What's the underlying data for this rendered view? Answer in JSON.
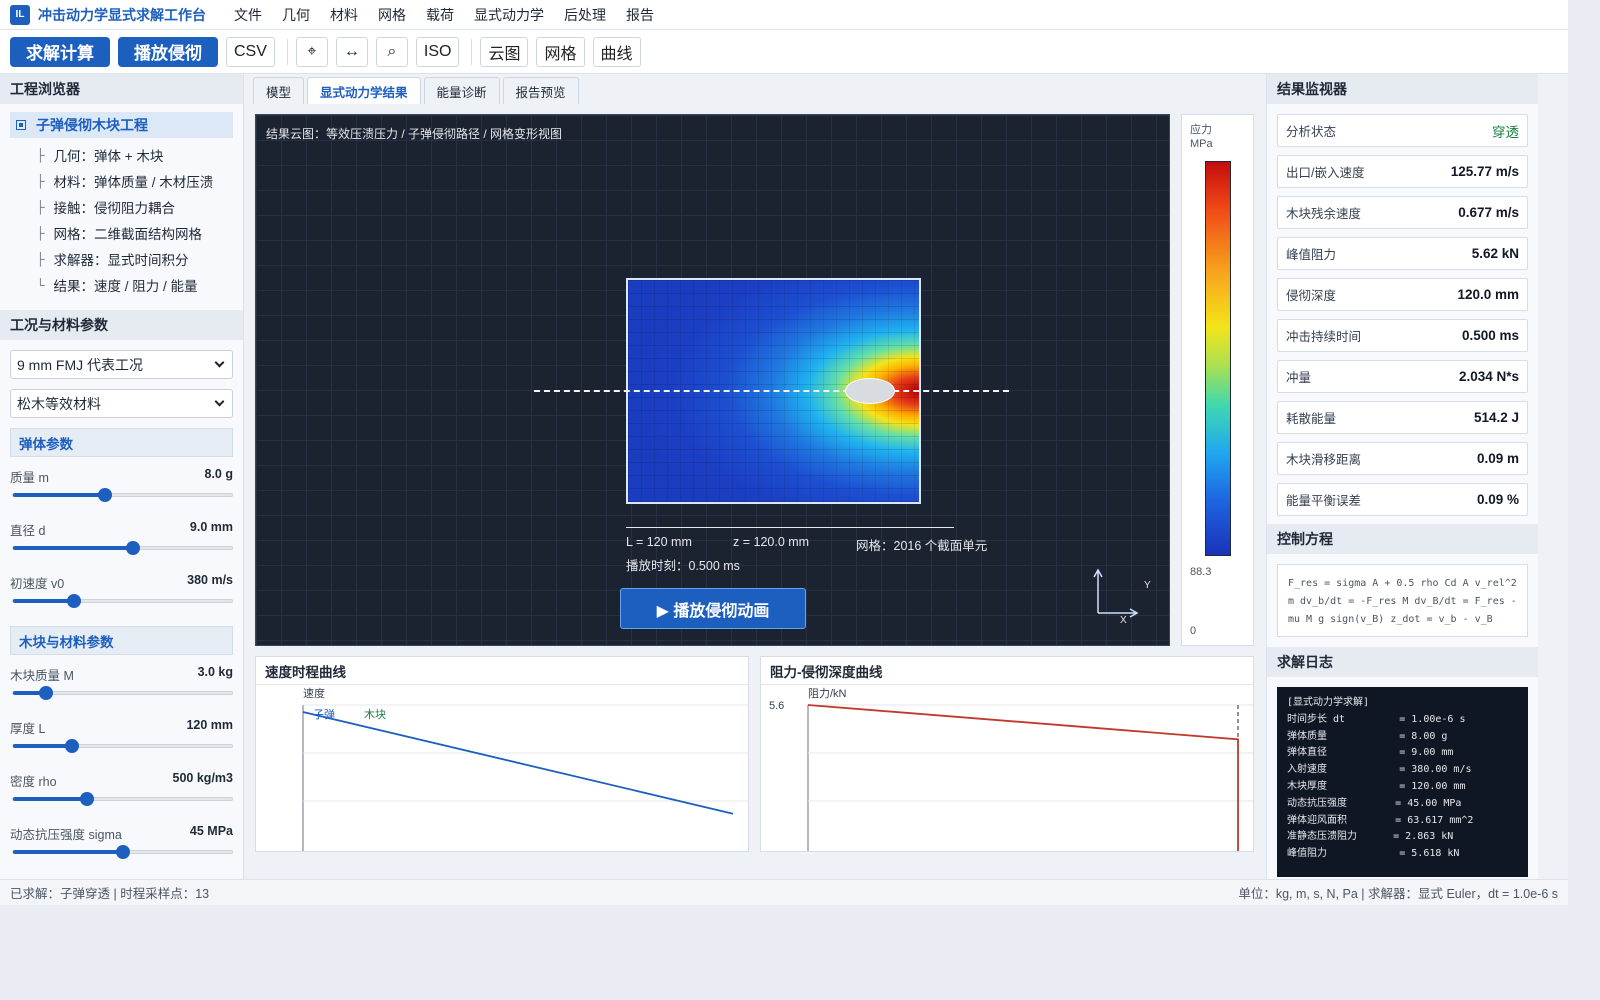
{
  "app": {
    "logo": "IL",
    "title": "冲击动力学显式求解工作台"
  },
  "menu": [
    "文件",
    "几何",
    "材料",
    "网格",
    "载荷",
    "显式动力学",
    "后处理",
    "报告"
  ],
  "toolbar": {
    "solve": "求解计算",
    "play": "播放侵彻",
    "csv": "CSV",
    "fit": "⌖",
    "pan": "↔",
    "zoom": "⌕",
    "iso": "ISO",
    "contour": "云图",
    "mesh": "网格",
    "curve": "曲线"
  },
  "browser": {
    "title": "工程浏览器",
    "root": "子弹侵彻木块工程",
    "items": [
      {
        "branch": "├",
        "label": "几何：弹体 + 木块"
      },
      {
        "branch": "├",
        "label": "材料：弹体质量 / 木材压溃"
      },
      {
        "branch": "├",
        "label": "接触：侵彻阻力耦合"
      },
      {
        "branch": "├",
        "label": "网格：二维截面结构网格"
      },
      {
        "branch": "├",
        "label": "求解器：显式时间积分"
      },
      {
        "branch": "└",
        "label": "结果：速度 / 阻力 / 能量"
      }
    ]
  },
  "params": {
    "title": "工况与材料参数",
    "case": "9 mm FMJ 代表工况",
    "material": "松木等效材料",
    "bullet_title": "弹体参数",
    "bullet": [
      {
        "label": "质量 m",
        "value": "8.0 g",
        "fraction": 0.42
      },
      {
        "label": "直径 d",
        "value": "9.0 mm",
        "fraction": 0.55
      },
      {
        "label": "初速度 v0",
        "value": "380 m/s",
        "fraction": 0.28
      }
    ],
    "block_title": "木块与材料参数",
    "block": [
      {
        "label": "木块质量 M",
        "value": "3.0 kg",
        "fraction": 0.15
      },
      {
        "label": "厚度 L",
        "value": "120 mm",
        "fraction": 0.27
      },
      {
        "label": "密度 rho",
        "value": "500 kg/m3",
        "fraction": 0.34
      },
      {
        "label": "动态抗压强度 sigma",
        "value": "45 MPa",
        "fraction": 0.5
      }
    ]
  },
  "tabs": [
    "模型",
    "显式动力学结果",
    "能量诊断",
    "报告预览"
  ],
  "viewport": {
    "title": "结果云图：等效压溃压力 / 子弹侵彻路径 / 网格变形视图",
    "length": "L = 120 mm",
    "depth": "z = 120.0 mm",
    "mesh": "网格：2016 个截面单元",
    "time": "播放时刻：0.500 ms",
    "play_button": "▶ 播放侵彻动画",
    "axis_y": "Y",
    "axis_x": "X"
  },
  "legend": {
    "title": "应力",
    "unit": "MPa",
    "max": "88.3",
    "min": "0"
  },
  "velocity_chart": {
    "title": "速度时程曲线",
    "ylabel": "速度",
    "series_labels": [
      "子弹",
      "木块"
    ]
  },
  "force_chart": {
    "title": "阻力-侵彻深度曲线",
    "ylabel": "阻力/kN",
    "ytick": "5.6"
  },
  "chart_data": [
    {
      "type": "line",
      "title": "速度时程曲线",
      "ylabel": "速度",
      "series": [
        {
          "name": "子弹",
          "x": [
            0,
            0.5
          ],
          "y": [
            380,
            125.77
          ]
        },
        {
          "name": "木块",
          "x": [
            0,
            0.5
          ],
          "y": [
            0,
            0.677
          ]
        }
      ]
    },
    {
      "type": "line",
      "title": "阻力-侵彻深度曲线",
      "ylabel": "阻力/kN",
      "series": [
        {
          "x": [
            0,
            120,
            120
          ],
          "y": [
            5.62,
            4.3,
            0
          ]
        }
      ]
    }
  ],
  "monitor": {
    "title": "结果监视器",
    "metrics": [
      {
        "label": "分析状态",
        "value": "穿透"
      },
      {
        "label": "出口/嵌入速度",
        "value": "125.77 m/s"
      },
      {
        "label": "木块残余速度",
        "value": "0.677 m/s"
      },
      {
        "label": "峰值阻力",
        "value": "5.62 kN"
      },
      {
        "label": "侵彻深度",
        "value": "120.0 mm"
      },
      {
        "label": "冲击持续时间",
        "value": "0.500 ms"
      },
      {
        "label": "冲量",
        "value": "2.034 N*s"
      },
      {
        "label": "耗散能量",
        "value": "514.2 J"
      },
      {
        "label": "木块滑移距离",
        "value": "0.09 m"
      },
      {
        "label": "能量平衡误差",
        "value": "0.09 %"
      }
    ]
  },
  "equations": {
    "title": "控制方程",
    "text": "F_res = sigma A + 0.5 rho Cd A v_rel^2 m dv_b/dt = -F_res M dv_B/dt = F_res - mu M g sign(v_B) z_dot = v_b - v_B"
  },
  "log": {
    "title": "求解日志",
    "lines": [
      "[显式动力学求解]",
      "时间步长 dt         = 1.00e-6 s",
      "弹体质量            = 8.00 g",
      "弹体直径            = 9.00 mm",
      "入射速度            = 380.00 m/s",
      "木块厚度            = 120.00 mm",
      "动态抗压强度        = 45.00 MPa",
      "弹体迎风面积        = 63.617 mm^2",
      "准静态压溃阻力      = 2.863 kN",
      "峰值阻力            = 5.618 kN"
    ]
  },
  "status": {
    "left": "已求解：子弹穿透 | 时程采样点：13",
    "right": "单位：kg, m, s, N, Pa | 求解器：显式 Euler，dt = 1.0e-6 s"
  }
}
